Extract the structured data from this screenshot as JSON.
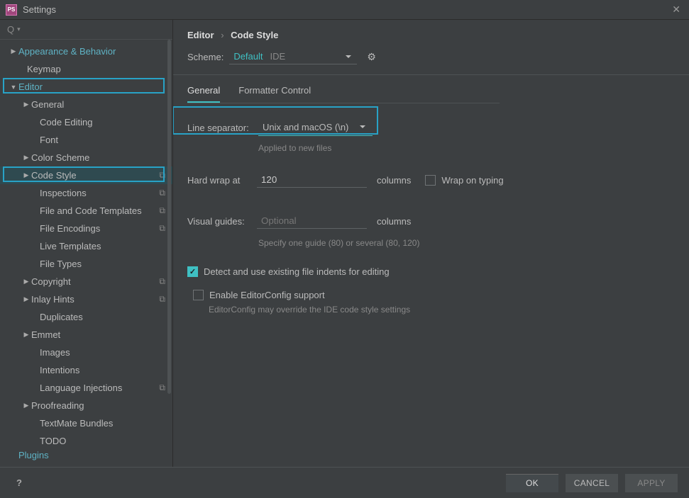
{
  "window": {
    "title": "Settings",
    "close_glyph": "✕"
  },
  "sidebar": {
    "items": [
      {
        "label": "Appearance & Behavior",
        "indent": 14,
        "arrow": "▶",
        "accent": true
      },
      {
        "label": "Keymap",
        "indent": 26,
        "arrow": ""
      },
      {
        "label": "Editor",
        "indent": 14,
        "arrow": "▼",
        "accent": true,
        "highlight": true
      },
      {
        "label": "General",
        "indent": 32,
        "arrow": "▶"
      },
      {
        "label": "Code Editing",
        "indent": 44,
        "arrow": ""
      },
      {
        "label": "Font",
        "indent": 44,
        "arrow": ""
      },
      {
        "label": "Color Scheme",
        "indent": 32,
        "arrow": "▶"
      },
      {
        "label": "Code Style",
        "indent": 32,
        "arrow": "▶",
        "icon": "⧉",
        "highlight": true,
        "selected": true
      },
      {
        "label": "Inspections",
        "indent": 44,
        "arrow": "",
        "icon": "⧉"
      },
      {
        "label": "File and Code Templates",
        "indent": 44,
        "arrow": "",
        "icon": "⧉"
      },
      {
        "label": "File Encodings",
        "indent": 44,
        "arrow": "",
        "icon": "⧉"
      },
      {
        "label": "Live Templates",
        "indent": 44,
        "arrow": ""
      },
      {
        "label": "File Types",
        "indent": 44,
        "arrow": ""
      },
      {
        "label": "Copyright",
        "indent": 32,
        "arrow": "▶",
        "icon": "⧉"
      },
      {
        "label": "Inlay Hints",
        "indent": 32,
        "arrow": "▶",
        "icon": "⧉"
      },
      {
        "label": "Duplicates",
        "indent": 44,
        "arrow": ""
      },
      {
        "label": "Emmet",
        "indent": 32,
        "arrow": "▶"
      },
      {
        "label": "Images",
        "indent": 44,
        "arrow": ""
      },
      {
        "label": "Intentions",
        "indent": 44,
        "arrow": ""
      },
      {
        "label": "Language Injections",
        "indent": 44,
        "arrow": "",
        "icon": "⧉"
      },
      {
        "label": "Proofreading",
        "indent": 32,
        "arrow": "▶"
      },
      {
        "label": "TextMate Bundles",
        "indent": 44,
        "arrow": ""
      },
      {
        "label": "TODO",
        "indent": 44,
        "arrow": ""
      },
      {
        "label": "Plugins",
        "indent": 14,
        "arrow": "",
        "accent": true,
        "cut": true
      }
    ]
  },
  "breadcrumb": {
    "root": "Editor",
    "leaf": "Code Style",
    "sep": "›"
  },
  "scheme": {
    "label": "Scheme:",
    "value": "Default",
    "badge": "IDE",
    "gear_glyph": "⚙"
  },
  "tabs": {
    "items": [
      "General",
      "Formatter Control"
    ],
    "active": 0
  },
  "line_separator": {
    "label": "Line separator:",
    "value": "Unix and macOS (\\n)",
    "hint": "Applied to new files"
  },
  "hard_wrap": {
    "label": "Hard wrap at",
    "value": "120",
    "suffix": "columns",
    "wrap_on_typing": "Wrap on typing",
    "wrap_checked": false
  },
  "visual_guides": {
    "label": "Visual guides:",
    "placeholder": "Optional",
    "suffix": "columns",
    "hint": "Specify one guide (80) or several (80, 120)"
  },
  "detect_indents": {
    "label": "Detect and use existing file indents for editing",
    "checked": true
  },
  "editorconfig": {
    "label": "Enable EditorConfig support",
    "checked": false,
    "hint": "EditorConfig may override the IDE code style settings"
  },
  "buttons": {
    "ok": "OK",
    "cancel": "CANCEL",
    "apply": "APPLY"
  }
}
